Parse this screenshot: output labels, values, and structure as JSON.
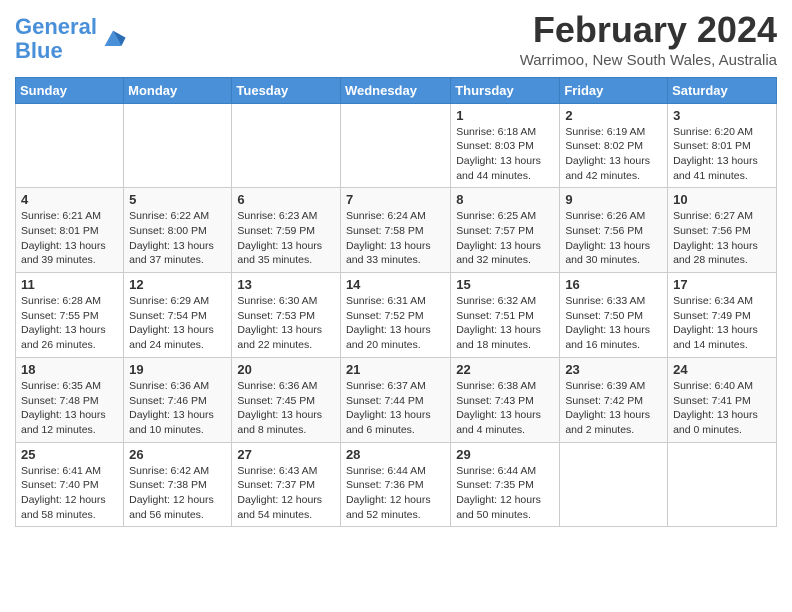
{
  "header": {
    "logo_line1": "General",
    "logo_line2": "Blue",
    "title": "February 2024",
    "subtitle": "Warrimoo, New South Wales, Australia"
  },
  "days_of_week": [
    "Sunday",
    "Monday",
    "Tuesday",
    "Wednesday",
    "Thursday",
    "Friday",
    "Saturday"
  ],
  "weeks": [
    [
      {
        "day": "",
        "info": ""
      },
      {
        "day": "",
        "info": ""
      },
      {
        "day": "",
        "info": ""
      },
      {
        "day": "",
        "info": ""
      },
      {
        "day": "1",
        "info": "Sunrise: 6:18 AM\nSunset: 8:03 PM\nDaylight: 13 hours\nand 44 minutes."
      },
      {
        "day": "2",
        "info": "Sunrise: 6:19 AM\nSunset: 8:02 PM\nDaylight: 13 hours\nand 42 minutes."
      },
      {
        "day": "3",
        "info": "Sunrise: 6:20 AM\nSunset: 8:01 PM\nDaylight: 13 hours\nand 41 minutes."
      }
    ],
    [
      {
        "day": "4",
        "info": "Sunrise: 6:21 AM\nSunset: 8:01 PM\nDaylight: 13 hours\nand 39 minutes."
      },
      {
        "day": "5",
        "info": "Sunrise: 6:22 AM\nSunset: 8:00 PM\nDaylight: 13 hours\nand 37 minutes."
      },
      {
        "day": "6",
        "info": "Sunrise: 6:23 AM\nSunset: 7:59 PM\nDaylight: 13 hours\nand 35 minutes."
      },
      {
        "day": "7",
        "info": "Sunrise: 6:24 AM\nSunset: 7:58 PM\nDaylight: 13 hours\nand 33 minutes."
      },
      {
        "day": "8",
        "info": "Sunrise: 6:25 AM\nSunset: 7:57 PM\nDaylight: 13 hours\nand 32 minutes."
      },
      {
        "day": "9",
        "info": "Sunrise: 6:26 AM\nSunset: 7:56 PM\nDaylight: 13 hours\nand 30 minutes."
      },
      {
        "day": "10",
        "info": "Sunrise: 6:27 AM\nSunset: 7:56 PM\nDaylight: 13 hours\nand 28 minutes."
      }
    ],
    [
      {
        "day": "11",
        "info": "Sunrise: 6:28 AM\nSunset: 7:55 PM\nDaylight: 13 hours\nand 26 minutes."
      },
      {
        "day": "12",
        "info": "Sunrise: 6:29 AM\nSunset: 7:54 PM\nDaylight: 13 hours\nand 24 minutes."
      },
      {
        "day": "13",
        "info": "Sunrise: 6:30 AM\nSunset: 7:53 PM\nDaylight: 13 hours\nand 22 minutes."
      },
      {
        "day": "14",
        "info": "Sunrise: 6:31 AM\nSunset: 7:52 PM\nDaylight: 13 hours\nand 20 minutes."
      },
      {
        "day": "15",
        "info": "Sunrise: 6:32 AM\nSunset: 7:51 PM\nDaylight: 13 hours\nand 18 minutes."
      },
      {
        "day": "16",
        "info": "Sunrise: 6:33 AM\nSunset: 7:50 PM\nDaylight: 13 hours\nand 16 minutes."
      },
      {
        "day": "17",
        "info": "Sunrise: 6:34 AM\nSunset: 7:49 PM\nDaylight: 13 hours\nand 14 minutes."
      }
    ],
    [
      {
        "day": "18",
        "info": "Sunrise: 6:35 AM\nSunset: 7:48 PM\nDaylight: 13 hours\nand 12 minutes."
      },
      {
        "day": "19",
        "info": "Sunrise: 6:36 AM\nSunset: 7:46 PM\nDaylight: 13 hours\nand 10 minutes."
      },
      {
        "day": "20",
        "info": "Sunrise: 6:36 AM\nSunset: 7:45 PM\nDaylight: 13 hours\nand 8 minutes."
      },
      {
        "day": "21",
        "info": "Sunrise: 6:37 AM\nSunset: 7:44 PM\nDaylight: 13 hours\nand 6 minutes."
      },
      {
        "day": "22",
        "info": "Sunrise: 6:38 AM\nSunset: 7:43 PM\nDaylight: 13 hours\nand 4 minutes."
      },
      {
        "day": "23",
        "info": "Sunrise: 6:39 AM\nSunset: 7:42 PM\nDaylight: 13 hours\nand 2 minutes."
      },
      {
        "day": "24",
        "info": "Sunrise: 6:40 AM\nSunset: 7:41 PM\nDaylight: 13 hours\nand 0 minutes."
      }
    ],
    [
      {
        "day": "25",
        "info": "Sunrise: 6:41 AM\nSunset: 7:40 PM\nDaylight: 12 hours\nand 58 minutes."
      },
      {
        "day": "26",
        "info": "Sunrise: 6:42 AM\nSunset: 7:38 PM\nDaylight: 12 hours\nand 56 minutes."
      },
      {
        "day": "27",
        "info": "Sunrise: 6:43 AM\nSunset: 7:37 PM\nDaylight: 12 hours\nand 54 minutes."
      },
      {
        "day": "28",
        "info": "Sunrise: 6:44 AM\nSunset: 7:36 PM\nDaylight: 12 hours\nand 52 minutes."
      },
      {
        "day": "29",
        "info": "Sunrise: 6:44 AM\nSunset: 7:35 PM\nDaylight: 12 hours\nand 50 minutes."
      },
      {
        "day": "",
        "info": ""
      },
      {
        "day": "",
        "info": ""
      }
    ]
  ]
}
